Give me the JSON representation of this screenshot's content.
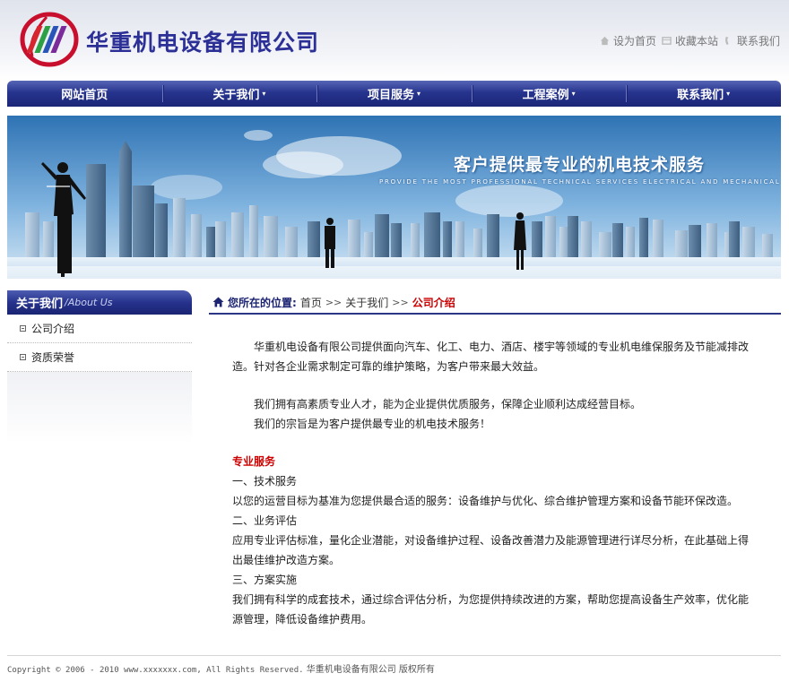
{
  "header": {
    "company_name": "华重机电设备有限公司",
    "links": [
      {
        "label": "设为首页",
        "icon": "home-icon"
      },
      {
        "label": "收藏本站",
        "icon": "bookmark-icon"
      },
      {
        "label": "联系我们",
        "icon": "phone-icon"
      }
    ]
  },
  "nav": [
    {
      "label": "网站首页",
      "has_caret": false
    },
    {
      "label": "关于我们",
      "has_caret": true
    },
    {
      "label": "项目服务",
      "has_caret": true
    },
    {
      "label": "工程案例",
      "has_caret": true
    },
    {
      "label": "联系我们",
      "has_caret": true
    }
  ],
  "nav_caret": "▾",
  "banner": {
    "slogan": "客户提供最专业的机电技术服务",
    "eng": "PROVIDE THE MOST PROFESSIONAL TECHNICAL SERVICES ELECTRICAL AND MECHANICAL"
  },
  "sidebar": {
    "title": "关于我们",
    "subtitle": "/About Us",
    "items": [
      {
        "label": "公司介绍"
      },
      {
        "label": "资质荣誉"
      }
    ]
  },
  "breadcrumb": {
    "location_label": "您所在的位置:",
    "sep": ">>",
    "links": [
      "首页",
      "关于我们"
    ],
    "current": "公司介绍"
  },
  "content": {
    "intro": "华重机电设备有限公司提供面向汽车、化工、电力、酒店、楼宇等领域的专业机电维保服务及节能减排改造。针对各企业需求制定可靠的维护策略，为客户带来最大效益。",
    "talent": "我们拥有高素质专业人才，能为企业提供优质服务，保障企业顺利达成经营目标。",
    "mission": "我们的宗旨是为客户提供最专业的机电技术服务！",
    "section_title": "专业服务",
    "s1_title": "一、技术服务",
    "s1_text": "以您的运营目标为基准为您提供最合适的服务：设备维护与优化、综合维护管理方案和设备节能环保改造。",
    "s2_title": "二、业务评估",
    "s2_text": "应用专业评估标准，量化企业潜能，对设备维护过程、设备改善潜力及能源管理进行详尽分析，在此基础上得出最佳维护改造方案。",
    "s3_title": "三、方案实施",
    "s3_text": "我们拥有科学的成套技术，通过综合评估分析，为您提供持续改进的方案，帮助您提高设备生产效率，优化能源管理，降低设备维护费用。"
  },
  "footer": {
    "copyright": "Copyright © 2006 - 2010 www.xxxxxxx.com, All Rights Reserved.",
    "owner": "华重机电设备有限公司 版权所有"
  },
  "colors": {
    "nav_dark": "#1b2677",
    "brand_text": "#2b2f96",
    "current_crumb": "#cc0000"
  }
}
